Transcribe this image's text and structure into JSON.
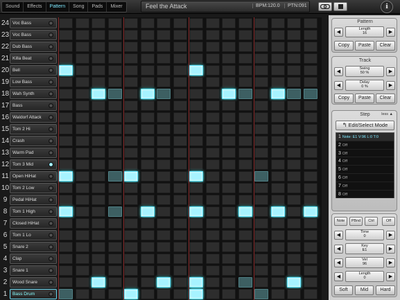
{
  "tabs": [
    {
      "label": "Sound",
      "active": false
    },
    {
      "label": "Effects",
      "active": false
    },
    {
      "label": "Pattern",
      "active": true
    },
    {
      "label": "Song",
      "active": false
    },
    {
      "label": "Pads",
      "active": false
    },
    {
      "label": "Mixer",
      "active": false
    }
  ],
  "header": {
    "song_name": "Feel the Attack",
    "bpm": "BPM:120.0",
    "pattern": "PTN:091",
    "info_label": "i"
  },
  "tracks": [
    {
      "num": "24",
      "label": "Voc Bass",
      "led": false,
      "selected": false
    },
    {
      "num": "23",
      "label": "Voc Bass",
      "led": false,
      "selected": false
    },
    {
      "num": "22",
      "label": "Dub Bass",
      "led": false,
      "selected": false
    },
    {
      "num": "21",
      "label": "Killa Beat",
      "led": false,
      "selected": false
    },
    {
      "num": "20",
      "label": "Bell",
      "led": false,
      "selected": false
    },
    {
      "num": "19",
      "label": "Low Bass",
      "led": false,
      "selected": false
    },
    {
      "num": "18",
      "label": "Wah Synth",
      "led": false,
      "selected": false
    },
    {
      "num": "17",
      "label": "Bass",
      "led": false,
      "selected": false
    },
    {
      "num": "16",
      "label": "Waldorf Attack",
      "led": false,
      "selected": false
    },
    {
      "num": "15",
      "label": "Tom 2 Hi",
      "led": false,
      "selected": false
    },
    {
      "num": "14",
      "label": "Crash",
      "led": false,
      "selected": false
    },
    {
      "num": "13",
      "label": "Warm Pad",
      "led": false,
      "selected": false
    },
    {
      "num": "12",
      "label": "Tom 3 Mid",
      "led": true,
      "selected": false
    },
    {
      "num": "11",
      "label": "Open HiHat",
      "led": false,
      "selected": false
    },
    {
      "num": "10",
      "label": "Tom 2 Low",
      "led": false,
      "selected": false
    },
    {
      "num": "9",
      "label": "Pedal HiHat",
      "led": false,
      "selected": false
    },
    {
      "num": "8",
      "label": "Tom 1 High",
      "led": false,
      "selected": false
    },
    {
      "num": "7",
      "label": "Closed HiHat",
      "led": false,
      "selected": false
    },
    {
      "num": "6",
      "label": "Tom 1 Lo",
      "led": false,
      "selected": false
    },
    {
      "num": "5",
      "label": "Snare 2",
      "led": false,
      "selected": false
    },
    {
      "num": "4",
      "label": "Clap",
      "led": false,
      "selected": false
    },
    {
      "num": "3",
      "label": "Snare 1",
      "led": false,
      "selected": false
    },
    {
      "num": "2",
      "label": "Wood Snare",
      "led": false,
      "selected": false
    },
    {
      "num": "1",
      "label": "Bass Drum",
      "led": false,
      "selected": true
    }
  ],
  "grid": {
    "steps": 16,
    "active_cells": [
      {
        "row": 4,
        "step": 0,
        "level": "on"
      },
      {
        "row": 4,
        "step": 8,
        "level": "on"
      },
      {
        "row": 6,
        "step": 2,
        "level": "on"
      },
      {
        "row": 6,
        "step": 3,
        "level": "half"
      },
      {
        "row": 6,
        "step": 5,
        "level": "on"
      },
      {
        "row": 6,
        "step": 6,
        "level": "half"
      },
      {
        "row": 6,
        "step": 10,
        "level": "on"
      },
      {
        "row": 6,
        "step": 11,
        "level": "half"
      },
      {
        "row": 6,
        "step": 13,
        "level": "on"
      },
      {
        "row": 6,
        "step": 14,
        "level": "half"
      },
      {
        "row": 6,
        "step": 15,
        "level": "half"
      },
      {
        "row": 13,
        "step": 0,
        "level": "on"
      },
      {
        "row": 13,
        "step": 3,
        "level": "half"
      },
      {
        "row": 13,
        "step": 4,
        "level": "on"
      },
      {
        "row": 13,
        "step": 8,
        "level": "on"
      },
      {
        "row": 13,
        "step": 12,
        "level": "half"
      },
      {
        "row": 16,
        "step": 0,
        "level": "on"
      },
      {
        "row": 16,
        "step": 3,
        "level": "half"
      },
      {
        "row": 16,
        "step": 5,
        "level": "on"
      },
      {
        "row": 16,
        "step": 8,
        "level": "on"
      },
      {
        "row": 16,
        "step": 11,
        "level": "on"
      },
      {
        "row": 16,
        "step": 13,
        "level": "on"
      },
      {
        "row": 16,
        "step": 15,
        "level": "on"
      },
      {
        "row": 22,
        "step": 2,
        "level": "on"
      },
      {
        "row": 22,
        "step": 6,
        "level": "on"
      },
      {
        "row": 22,
        "step": 8,
        "level": "on"
      },
      {
        "row": 22,
        "step": 11,
        "level": "half"
      },
      {
        "row": 22,
        "step": 14,
        "level": "on"
      },
      {
        "row": 23,
        "step": 0,
        "level": "half"
      },
      {
        "row": 23,
        "step": 4,
        "level": "on"
      },
      {
        "row": 23,
        "step": 8,
        "level": "on"
      },
      {
        "row": 23,
        "step": 12,
        "level": "half"
      }
    ]
  },
  "pattern": {
    "title": "Pattern",
    "length_label": "Length",
    "length_value": "16",
    "copy": "Copy",
    "paste": "Paste",
    "clear": "Clear"
  },
  "track_section": {
    "title": "Track",
    "swing_label": "Swing",
    "swing_value": "50 %",
    "delay_label": "Delay",
    "delay_value": "0 %",
    "copy": "Copy",
    "paste": "Paste",
    "clear": "Clear"
  },
  "step": {
    "title": "Step",
    "less_label": "less ▲",
    "edit_select": "Edit/Select Mode",
    "list": [
      {
        "num": "1",
        "text": "Note: E1 V:96 L:0 T:0",
        "selected": true
      },
      {
        "num": "2",
        "text": "Off",
        "selected": false
      },
      {
        "num": "3",
        "text": "Off",
        "selected": false
      },
      {
        "num": "4",
        "text": "Off",
        "selected": false
      },
      {
        "num": "5",
        "text": "Off",
        "selected": false
      },
      {
        "num": "6",
        "text": "Off",
        "selected": false
      },
      {
        "num": "7",
        "text": "Off",
        "selected": false
      },
      {
        "num": "8",
        "text": "Off",
        "selected": false
      }
    ],
    "mode_note": "Note",
    "mode_pbnd": "PBnd",
    "mode_ctrl": "Ctrl",
    "mode_off": "Off",
    "time_label": "Time",
    "time_value": "0",
    "key_label": "Key",
    "key_value": "E1",
    "vel_label": "Vel",
    "vel_value": "96",
    "len_label": "Length",
    "len_value": "0",
    "soft": "Soft",
    "mid": "Mid",
    "hard": "Hard"
  },
  "colors": {
    "accent": "#7fe9ff",
    "step_on": "#a6f3ff",
    "bar_line": "#8a2a2a"
  }
}
